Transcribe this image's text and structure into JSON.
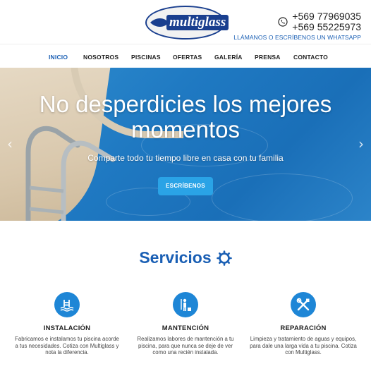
{
  "header": {
    "logo_text": "multiglass",
    "phones": [
      "+569 77969035",
      "+569 55225973"
    ],
    "cta": "LLÁMANOS O ESCRÍBENOS UN WHATSAPP"
  },
  "nav": {
    "items": [
      "INICIO",
      "NOSOTROS",
      "PISCINAS",
      "OFERTAS",
      "GALERÍA",
      "PRENSA",
      "CONTACTO"
    ],
    "active": "INICIO"
  },
  "hero": {
    "title_line1": "No desperdicies los mejores",
    "title_line2": "momentos",
    "subtitle": "Comparte todo tu tiempo libre en casa con tu familia",
    "button": "ESCRÍBENOS",
    "prev_arrow": "‹",
    "next_arrow": "›"
  },
  "services": {
    "title": "Servicios",
    "items": [
      {
        "title": "INSTALACIÓN",
        "icon": "pool-ladder-icon",
        "lines": [
          "Fabricamos e instalamos tu piscina acorde",
          "a tus necesidades. Cotiza con Multiglass y",
          "nota la diferencia."
        ]
      },
      {
        "title": "MANTENCIÓN",
        "icon": "cleaning-person-icon",
        "lines": [
          "Realizamos labores de mantención a tu",
          "piscina, para que nunca se deje de ver",
          "como una recién instalada."
        ]
      },
      {
        "title": "REPARACIÓN",
        "icon": "tools-icon",
        "lines": [
          "Limpieza y tratamiento de aguas y equipos,",
          "para dale una larga vida a tu piscina. Cotiza",
          "con Multiglass."
        ]
      }
    ]
  },
  "colors": {
    "accent": "#1a5fb4",
    "button": "#2aa3e6",
    "icon_circle": "#1e86d6"
  }
}
